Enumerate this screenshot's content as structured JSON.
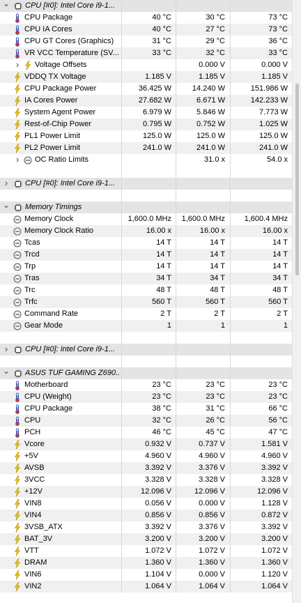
{
  "rows": [
    {
      "type": "hdr",
      "exp": "v",
      "icon": "chip",
      "name": "CPU [#0]: Intel Core i9-1..."
    },
    {
      "type": "row",
      "icon": "thermo",
      "name": "CPU Package",
      "v1": "40 °C",
      "v2": "30 °C",
      "v3": "73 °C"
    },
    {
      "type": "row",
      "icon": "thermo",
      "name": "CPU IA Cores",
      "v1": "40 °C",
      "v2": "27 °C",
      "v3": "73 °C"
    },
    {
      "type": "row",
      "icon": "thermo",
      "name": "CPU GT Cores (Graphics)",
      "v1": "31 °C",
      "v2": "29 °C",
      "v3": "36 °C"
    },
    {
      "type": "row",
      "icon": "thermo",
      "name": "VR VCC Temperature (SV...",
      "v1": "33 °C",
      "v2": "32 °C",
      "v3": "33 °C"
    },
    {
      "type": "row",
      "exp": ">",
      "icon": "bolt",
      "name": "Voltage Offsets",
      "v1": "",
      "v2": "0.000 V",
      "v3": "0.000 V",
      "indent": 1
    },
    {
      "type": "row",
      "icon": "bolt",
      "name": "VDDQ TX Voltage",
      "v1": "1.185 V",
      "v2": "1.185 V",
      "v3": "1.185 V"
    },
    {
      "type": "row",
      "icon": "bolt",
      "name": "CPU Package Power",
      "v1": "36.425 W",
      "v2": "14.240 W",
      "v3": "151.986 W"
    },
    {
      "type": "row",
      "icon": "bolt",
      "name": "IA Cores Power",
      "v1": "27.682 W",
      "v2": "6.671 W",
      "v3": "142.233 W"
    },
    {
      "type": "row",
      "icon": "bolt",
      "name": "System Agent Power",
      "v1": "6.979 W",
      "v2": "5.846 W",
      "v3": "7.773 W"
    },
    {
      "type": "row",
      "icon": "bolt",
      "name": "Rest-of-Chip Power",
      "v1": "0.795 W",
      "v2": "0.752 W",
      "v3": "1.025 W"
    },
    {
      "type": "row",
      "icon": "bolt",
      "name": "PL1 Power Limit",
      "v1": "125.0 W",
      "v2": "125.0 W",
      "v3": "125.0 W"
    },
    {
      "type": "row",
      "icon": "bolt",
      "name": "PL2 Power Limit",
      "v1": "241.0 W",
      "v2": "241.0 W",
      "v3": "241.0 W"
    },
    {
      "type": "row",
      "exp": ">",
      "icon": "clock",
      "name": "OC Ratio Limits",
      "v1": "",
      "v2": "31.0 x",
      "v3": "54.0 x",
      "indent": 1
    },
    {
      "type": "blank"
    },
    {
      "type": "hdr",
      "exp": ">",
      "icon": "chip",
      "name": "CPU [#0]: Intel Core i9-1..."
    },
    {
      "type": "blank"
    },
    {
      "type": "hdr",
      "exp": "v",
      "icon": "chip",
      "name": "Memory Timings"
    },
    {
      "type": "row",
      "icon": "clock",
      "name": "Memory Clock",
      "v1": "1,600.0 MHz",
      "v2": "1,600.0 MHz",
      "v3": "1,600.4 MHz"
    },
    {
      "type": "row",
      "icon": "clock",
      "name": "Memory Clock Ratio",
      "v1": "16.00 x",
      "v2": "16.00 x",
      "v3": "16.00 x"
    },
    {
      "type": "row",
      "icon": "clock",
      "name": "Tcas",
      "v1": "14 T",
      "v2": "14 T",
      "v3": "14 T"
    },
    {
      "type": "row",
      "icon": "clock",
      "name": "Trcd",
      "v1": "14 T",
      "v2": "14 T",
      "v3": "14 T"
    },
    {
      "type": "row",
      "icon": "clock",
      "name": "Trp",
      "v1": "14 T",
      "v2": "14 T",
      "v3": "14 T"
    },
    {
      "type": "row",
      "icon": "clock",
      "name": "Tras",
      "v1": "34 T",
      "v2": "34 T",
      "v3": "34 T"
    },
    {
      "type": "row",
      "icon": "clock",
      "name": "Trc",
      "v1": "48 T",
      "v2": "48 T",
      "v3": "48 T"
    },
    {
      "type": "row",
      "icon": "clock",
      "name": "Trfc",
      "v1": "560 T",
      "v2": "560 T",
      "v3": "560 T"
    },
    {
      "type": "row",
      "icon": "clock",
      "name": "Command Rate",
      "v1": "2 T",
      "v2": "2 T",
      "v3": "2 T"
    },
    {
      "type": "row",
      "icon": "clock",
      "name": "Gear Mode",
      "v1": "1",
      "v2": "1",
      "v3": "1"
    },
    {
      "type": "blank"
    },
    {
      "type": "hdr",
      "exp": ">",
      "icon": "chip",
      "name": "CPU [#0]: Intel Core i9-1..."
    },
    {
      "type": "blank"
    },
    {
      "type": "hdr",
      "exp": "v",
      "icon": "chip",
      "name": "ASUS TUF GAMING Z690..."
    },
    {
      "type": "row",
      "icon": "thermo",
      "name": "Motherboard",
      "v1": "23 °C",
      "v2": "23 °C",
      "v3": "23 °C"
    },
    {
      "type": "row",
      "icon": "thermo",
      "name": "CPU (Weight)",
      "v1": "23 °C",
      "v2": "23 °C",
      "v3": "23 °C"
    },
    {
      "type": "row",
      "icon": "thermo",
      "name": "CPU Package",
      "v1": "38 °C",
      "v2": "31 °C",
      "v3": "66 °C"
    },
    {
      "type": "row",
      "icon": "thermo",
      "name": "CPU",
      "v1": "32 °C",
      "v2": "26 °C",
      "v3": "56 °C"
    },
    {
      "type": "row",
      "icon": "thermo",
      "name": "PCH",
      "v1": "46 °C",
      "v2": "45 °C",
      "v3": "47 °C"
    },
    {
      "type": "row",
      "icon": "bolt",
      "name": "Vcore",
      "v1": "0.932 V",
      "v2": "0.737 V",
      "v3": "1.581 V"
    },
    {
      "type": "row",
      "icon": "bolt",
      "name": "+5V",
      "v1": "4.960 V",
      "v2": "4.960 V",
      "v3": "4.960 V"
    },
    {
      "type": "row",
      "icon": "bolt",
      "name": "AVSB",
      "v1": "3.392 V",
      "v2": "3.376 V",
      "v3": "3.392 V"
    },
    {
      "type": "row",
      "icon": "bolt",
      "name": "3VCC",
      "v1": "3.328 V",
      "v2": "3.328 V",
      "v3": "3.328 V"
    },
    {
      "type": "row",
      "icon": "bolt",
      "name": "+12V",
      "v1": "12.096 V",
      "v2": "12.096 V",
      "v3": "12.096 V"
    },
    {
      "type": "row",
      "icon": "bolt",
      "name": "VIN8",
      "v1": "0.056 V",
      "v2": "0.000 V",
      "v3": "1.128 V"
    },
    {
      "type": "row",
      "icon": "bolt",
      "name": "VIN4",
      "v1": "0.856 V",
      "v2": "0.856 V",
      "v3": "0.872 V"
    },
    {
      "type": "row",
      "icon": "bolt",
      "name": "3VSB_ATX",
      "v1": "3.392 V",
      "v2": "3.376 V",
      "v3": "3.392 V"
    },
    {
      "type": "row",
      "icon": "bolt",
      "name": "BAT_3V",
      "v1": "3.200 V",
      "v2": "3.200 V",
      "v3": "3.200 V"
    },
    {
      "type": "row",
      "icon": "bolt",
      "name": "VTT",
      "v1": "1.072 V",
      "v2": "1.072 V",
      "v3": "1.072 V"
    },
    {
      "type": "row",
      "icon": "bolt",
      "name": "DRAM",
      "v1": "1.360 V",
      "v2": "1.360 V",
      "v3": "1.360 V"
    },
    {
      "type": "row",
      "icon": "bolt",
      "name": "VIN6",
      "v1": "1.104 V",
      "v2": "0.000 V",
      "v3": "1.120 V"
    },
    {
      "type": "row",
      "icon": "bolt",
      "name": "VIN2",
      "v1": "1.064 V",
      "v2": "1.064 V",
      "v3": "1.064 V"
    }
  ],
  "colors": {
    "thermo": "#3a5fc8",
    "thermo_bulb": "#d83020",
    "bolt": "#f2c200",
    "bolt_edge": "#b08a00",
    "chip": "#444444",
    "clock": "#555555"
  }
}
